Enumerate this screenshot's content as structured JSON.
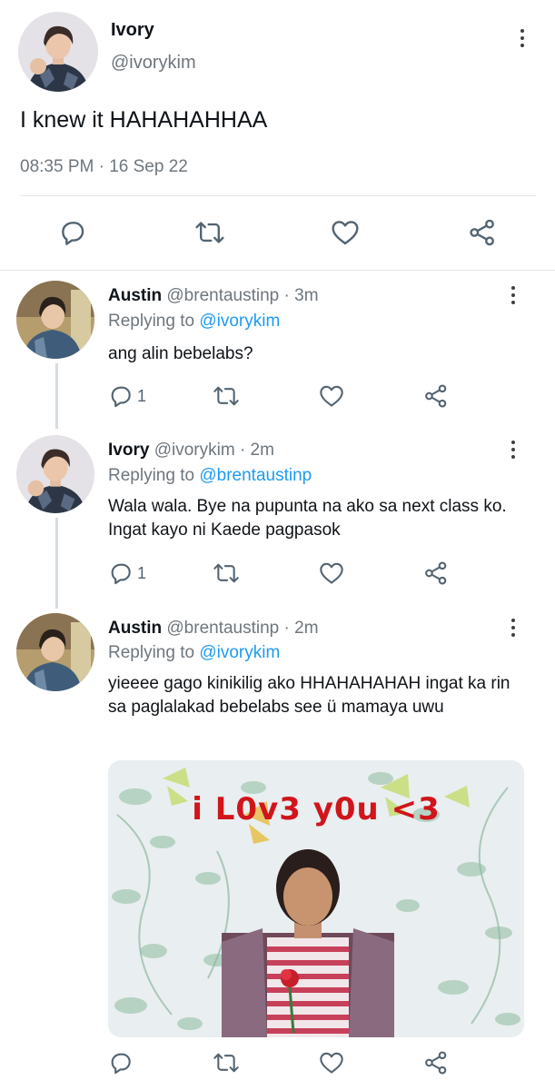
{
  "main_tweet": {
    "display_name": "Ivory",
    "handle": "@ivorykim",
    "text": "I knew it HAHAHAHHAA",
    "timestamp": "08:35 PM · 16 Sep 22",
    "actions": [
      "reply-icon",
      "retweet-icon",
      "like-icon",
      "share-icon"
    ]
  },
  "replies": [
    {
      "display_name": "Austin",
      "handle": "@brentaustinp",
      "time": "· 3m",
      "replying_label": "Replying to ",
      "replying_to": "@ivorykim",
      "text": "ang alin bebelabs?",
      "reply_count": "1"
    },
    {
      "display_name": "Ivory",
      "handle": "@ivorykim",
      "time": "· 2m",
      "replying_label": "Replying to ",
      "replying_to": "@brentaustinp",
      "text": "Wala wala. Bye na pupunta na ako sa next class ko. Ingat kayo ni Kaede pagpasok",
      "reply_count": "1"
    },
    {
      "display_name": "Austin",
      "handle": "@brentaustinp",
      "time": "· 2m",
      "replying_label": "Replying to ",
      "replying_to": "@ivorykim",
      "text": "yieeee gago kinikilig ako HHAHAHAHAH ingat ka rin sa paglalakad bebelabs see ü mamaya uwu",
      "media_caption": "i L0v3 y0u <3"
    }
  ],
  "colors": {
    "link": "#1d9bf0",
    "secondary_text": "#6e767d",
    "icon": "#536471",
    "caption_red": "#d0151b"
  }
}
